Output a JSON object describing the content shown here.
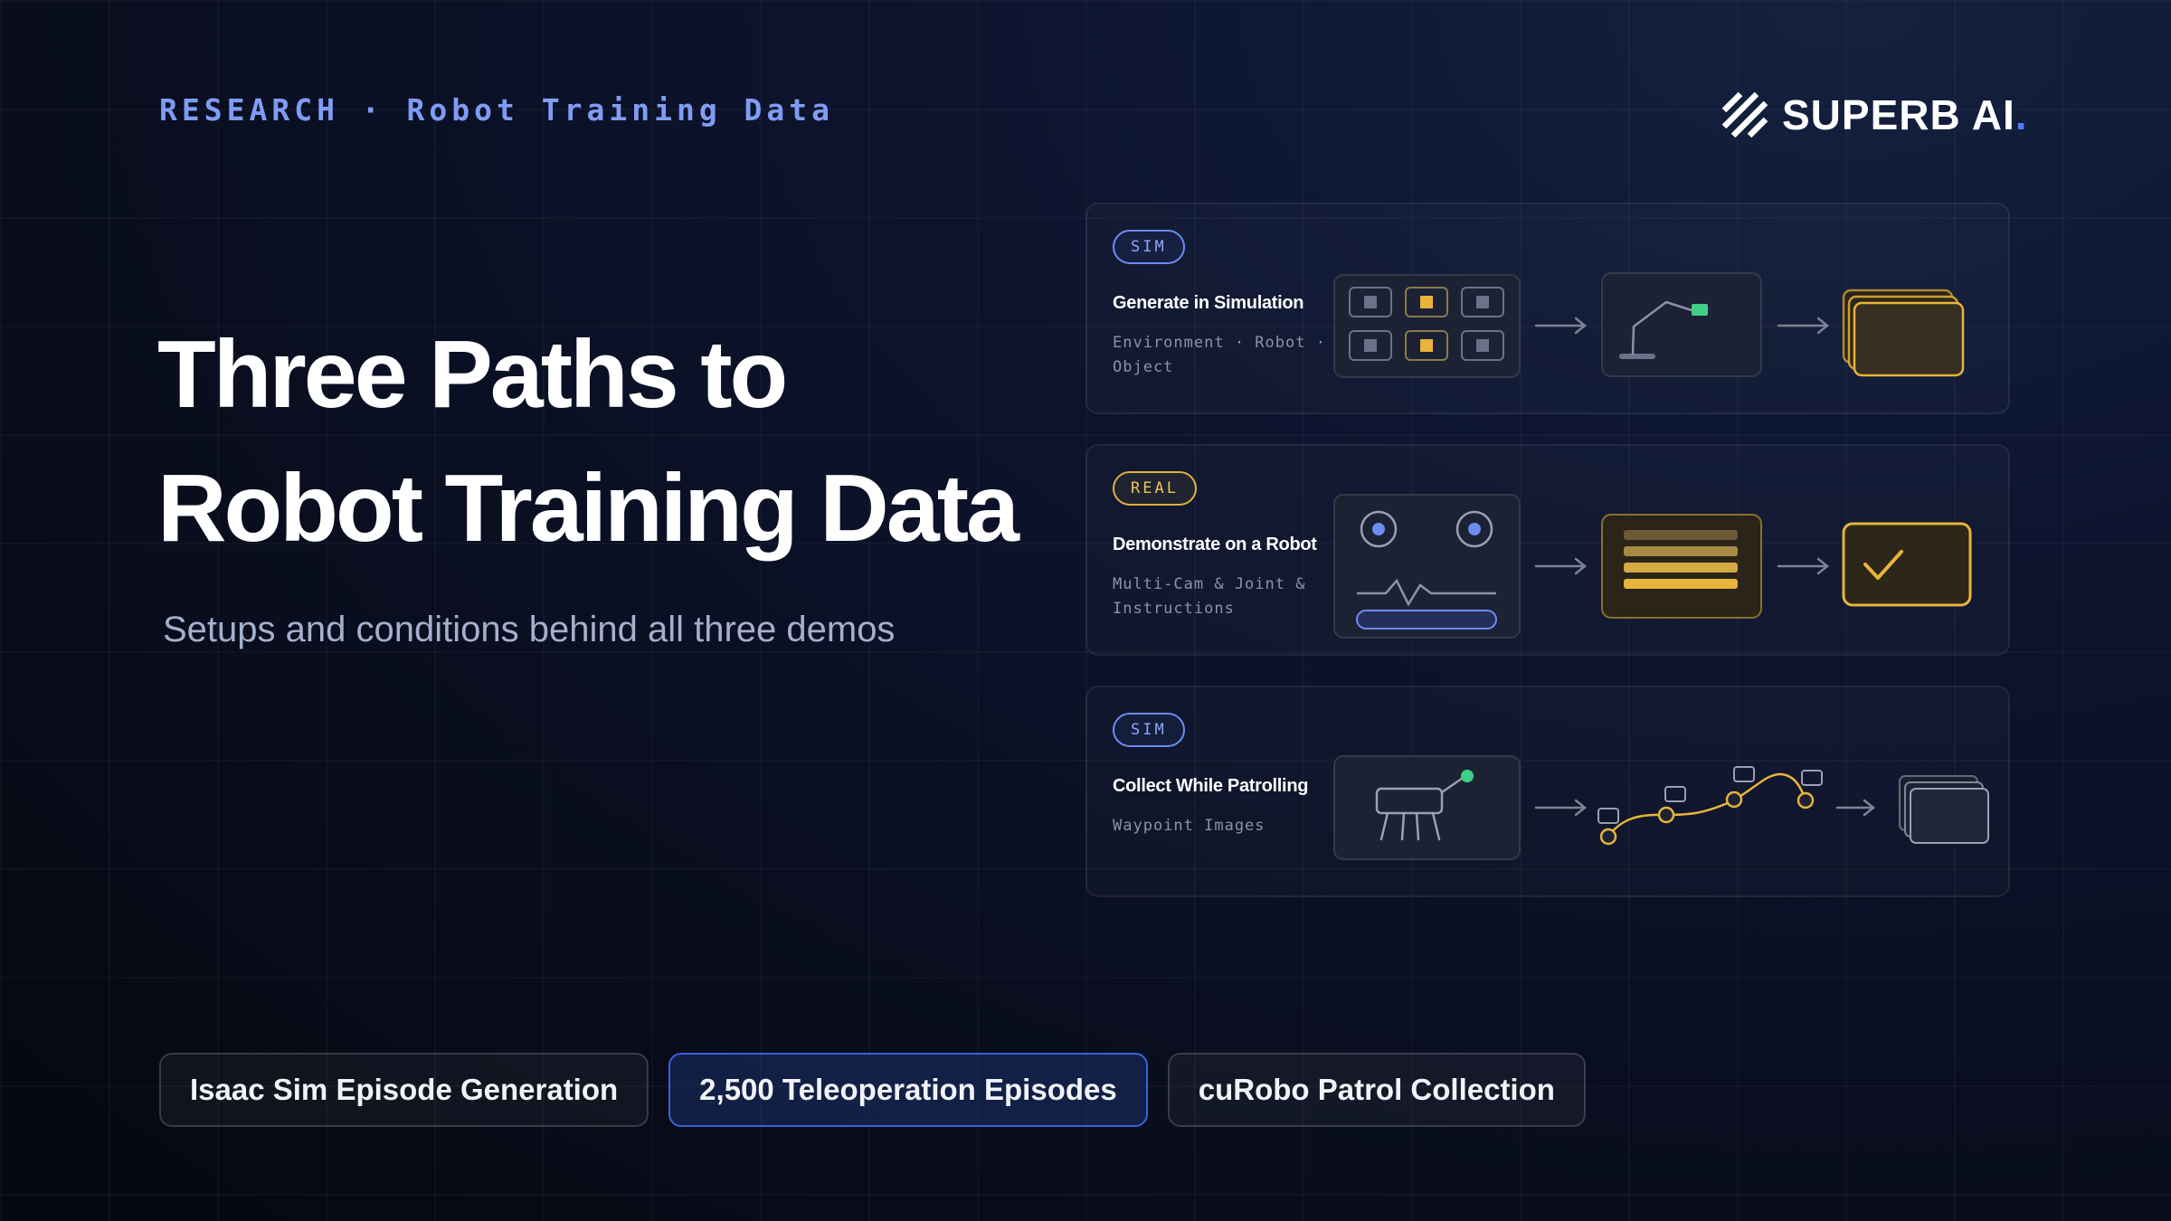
{
  "header": {
    "eyebrow": "RESEARCH · Robot Training Data",
    "logo_text": "SUPERB AI",
    "logo_dot": "."
  },
  "hero": {
    "title_line1": "Three Paths to",
    "title_line2": "Robot Training Data",
    "subtitle": "Setups and conditions behind all three demos"
  },
  "cards": [
    {
      "badge": "SIM",
      "title": "Generate in Simulation",
      "subtitle": "Environment · Robot · Object"
    },
    {
      "badge": "REAL",
      "title": "Demonstrate on a Robot",
      "subtitle": "Multi-Cam & Joint & Instructions"
    },
    {
      "badge": "SIM",
      "title": "Collect While Patrolling",
      "subtitle": "Waypoint Images"
    }
  ],
  "pills": [
    {
      "label": "Isaac Sim Episode Generation",
      "active": false
    },
    {
      "label": "2,500 Teleoperation Episodes",
      "active": true
    },
    {
      "label": "cuRobo Patrol Collection",
      "active": false
    }
  ],
  "colors": {
    "accent_blue": "#7f9cf5",
    "accent_gold": "#e8b43a",
    "accent_green": "#3fcf86",
    "background": "#0a0f22"
  },
  "icons": {
    "logo": "superb-ai-logo-icon",
    "arrow": "arrow-right-icon",
    "check": "checkmark-icon"
  }
}
